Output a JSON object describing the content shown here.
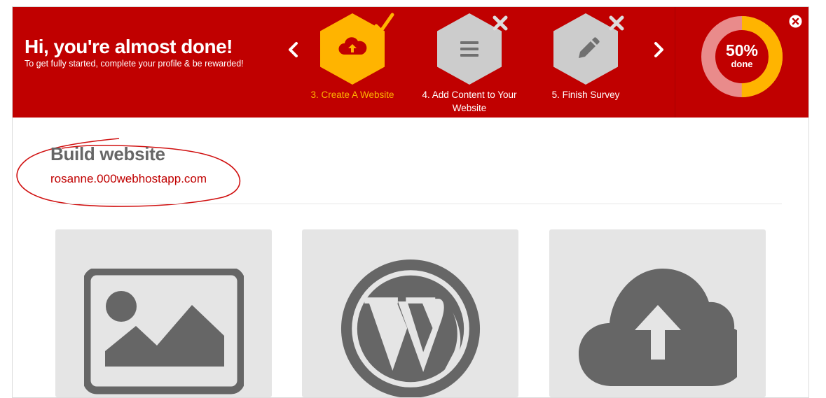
{
  "banner": {
    "title": "Hi, you're almost done!",
    "subtitle": "To get fully started, complete your profile & be rewarded!",
    "background_color": "#c00000",
    "accent_color": "#ffb400"
  },
  "navigation": {
    "prev_icon": "chevron-left-icon",
    "next_icon": "chevron-right-icon"
  },
  "steps": [
    {
      "label": "3. Create A Website",
      "status": "completed",
      "icon": "cloud-upload-icon",
      "badge": "checkmark-icon"
    },
    {
      "label": "4. Add Content to Your Website",
      "status": "incomplete",
      "icon": "list-icon",
      "badge": "x-icon"
    },
    {
      "label": "5. Finish Survey",
      "status": "incomplete",
      "icon": "pencil-icon",
      "badge": "x-icon"
    }
  ],
  "progress": {
    "percent_text": "50%",
    "done_label": "done",
    "value": 0.5
  },
  "content": {
    "title": "Build website",
    "domain": "rosanne.000webhostapp.com"
  },
  "cards": [
    {
      "icon": "image-icon"
    },
    {
      "icon": "wordpress-icon"
    },
    {
      "icon": "cloud-upload-icon"
    }
  ]
}
